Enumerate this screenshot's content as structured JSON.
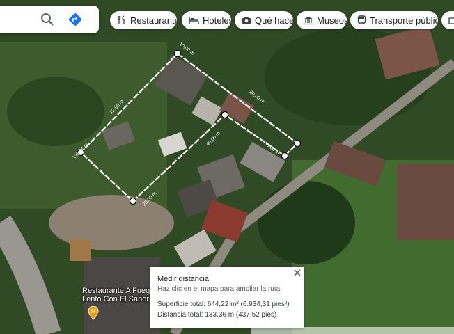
{
  "search": {
    "search_icon": "search-icon",
    "directions_icon": "directions-icon"
  },
  "chips": [
    {
      "label": "Restaurantes",
      "icon": "fork-knife-icon"
    },
    {
      "label": "Hoteles",
      "icon": "bed-icon"
    },
    {
      "label": "Qué hacer",
      "icon": "camera-icon"
    },
    {
      "label": "Museos",
      "icon": "museum-icon"
    },
    {
      "label": "Transporte público",
      "icon": "bus-icon"
    }
  ],
  "measure": {
    "segment_labels": [
      "10,00 m",
      "12,00 m",
      "133,36 m",
      "20,00 m",
      "40,00 m",
      "80,00 m",
      "60,00 m"
    ]
  },
  "info_panel": {
    "title": "Medir distancia",
    "hint": "Haz clic en el mapa para ampliar la ruta",
    "area": "Superficie total: 644,22 m² (6.934,31 pies²)",
    "distance": "Distancia total: 133,36 m (437,52 pies)"
  },
  "poi": {
    "name": "Restaurante A Fuego Lento Con El Sabor D"
  },
  "colors": {
    "line": "#ffffff",
    "chip_bg": "#ffffff",
    "directions": "#1a73e8"
  }
}
